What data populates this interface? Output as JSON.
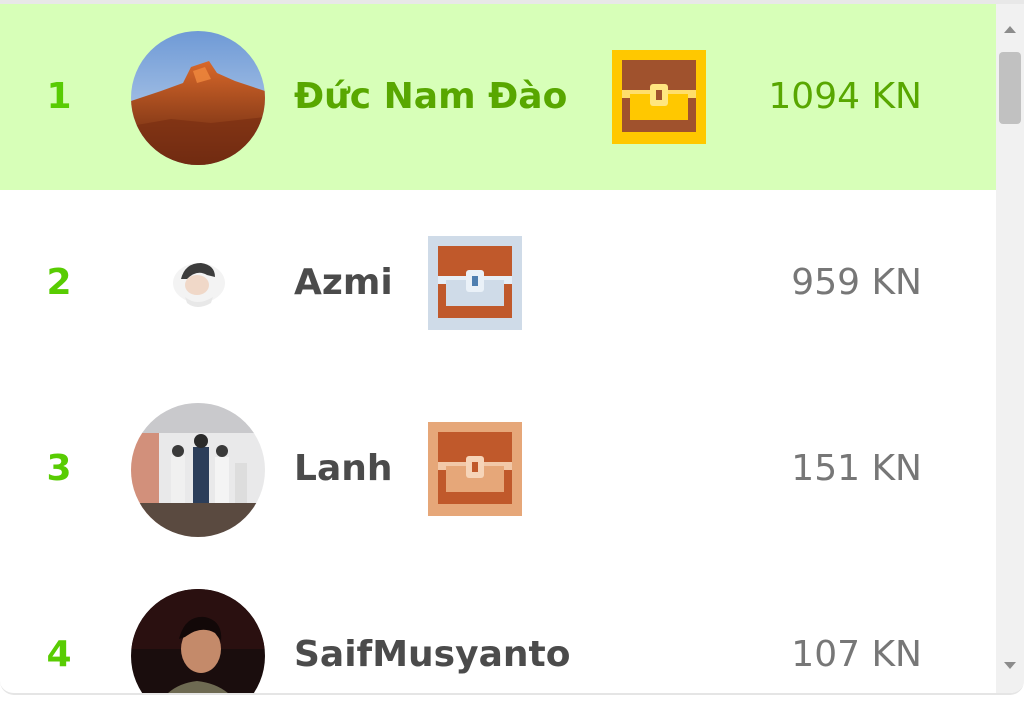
{
  "leaderboard": {
    "rows": [
      {
        "rank": "1",
        "name": "Đức Nam Đào",
        "xp": "1094 KN",
        "chest": "gold-chest-icon",
        "highlight": true
      },
      {
        "rank": "2",
        "name": "Azmi",
        "xp": "959 KN",
        "chest": "silver-chest-icon",
        "highlight": false
      },
      {
        "rank": "3",
        "name": "Lanh",
        "xp": "151 KN",
        "chest": "bronze-chest-icon",
        "highlight": false
      },
      {
        "rank": "4",
        "name": "SaifMusyanto",
        "xp": "107 KN",
        "chest": "",
        "highlight": false
      }
    ]
  },
  "colors": {
    "accent_green": "#58cc02",
    "highlight_background": "#d7ffb8",
    "highlight_text": "#58a700",
    "gold_chest": "#ffc800",
    "silver_chest": "#cfdbe8",
    "bronze_chest": "#e6a779"
  }
}
